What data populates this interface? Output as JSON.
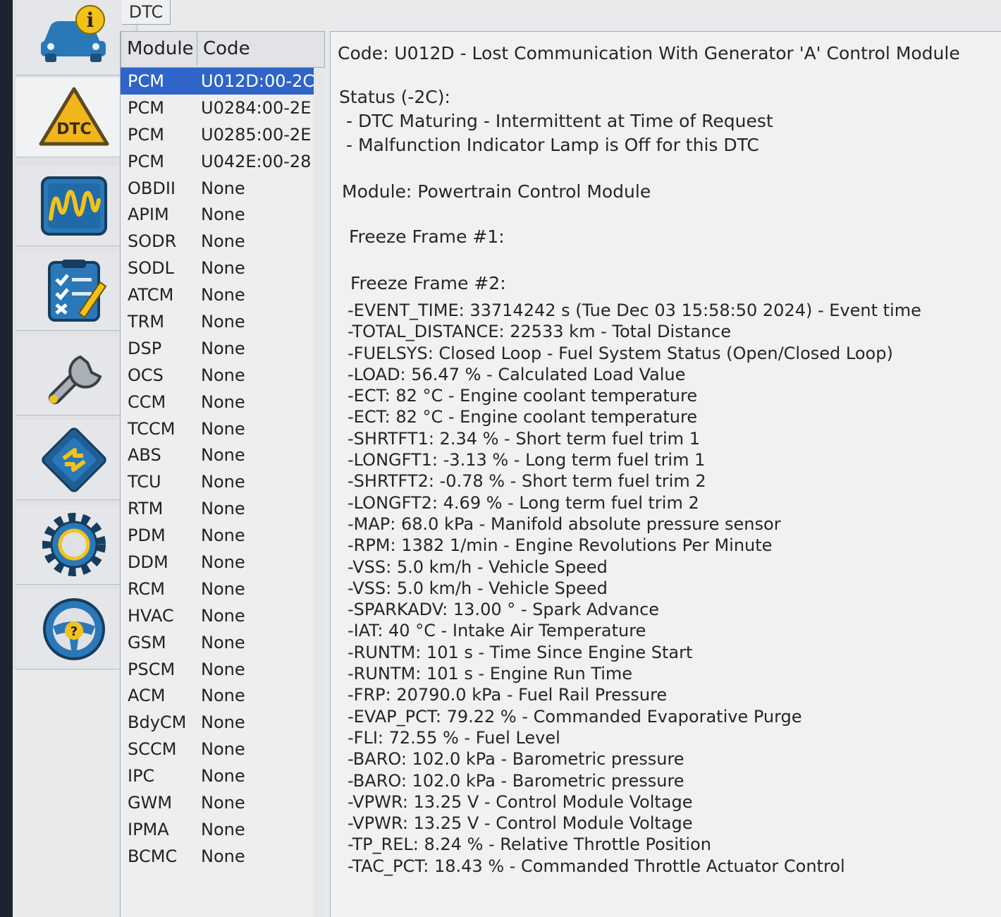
{
  "tab": {
    "label": "DTC"
  },
  "sidebar": {
    "items": [
      {
        "name": "vehicle-info",
        "icon": "car-info-icon",
        "badge": "i"
      },
      {
        "name": "dtc",
        "icon": "dtc-warning-icon",
        "badge": "DTC"
      },
      {
        "name": "live-data",
        "icon": "waveform-icon"
      },
      {
        "name": "checklist",
        "icon": "checklist-icon"
      },
      {
        "name": "service",
        "icon": "wrench-icon"
      },
      {
        "name": "modules",
        "icon": "chip-icon"
      },
      {
        "name": "settings",
        "icon": "gear-icon"
      },
      {
        "name": "help",
        "icon": "help-steering-icon",
        "badge": "?"
      }
    ]
  },
  "dtc_list": {
    "headers": {
      "module": "Module",
      "code": "Code"
    },
    "rows": [
      {
        "module": "PCM",
        "code": "U012D:00-2C",
        "selected": true
      },
      {
        "module": "PCM",
        "code": "U0284:00-2E"
      },
      {
        "module": "PCM",
        "code": "U0285:00-2E"
      },
      {
        "module": "PCM",
        "code": "U042E:00-28"
      },
      {
        "module": "OBDII",
        "code": "None"
      },
      {
        "module": "APIM",
        "code": "None"
      },
      {
        "module": "SODR",
        "code": "None"
      },
      {
        "module": "SODL",
        "code": "None"
      },
      {
        "module": "ATCM",
        "code": "None"
      },
      {
        "module": "TRM",
        "code": "None"
      },
      {
        "module": "DSP",
        "code": "None"
      },
      {
        "module": "OCS",
        "code": "None"
      },
      {
        "module": "CCM",
        "code": "None"
      },
      {
        "module": "TCCM",
        "code": "None"
      },
      {
        "module": "ABS",
        "code": "None"
      },
      {
        "module": "TCU",
        "code": "None"
      },
      {
        "module": "RTM",
        "code": "None"
      },
      {
        "module": "PDM",
        "code": "None"
      },
      {
        "module": "DDM",
        "code": "None"
      },
      {
        "module": "RCM",
        "code": "None"
      },
      {
        "module": "HVAC",
        "code": "None"
      },
      {
        "module": "GSM",
        "code": "None"
      },
      {
        "module": "PSCM",
        "code": "None"
      },
      {
        "module": "ACM",
        "code": "None"
      },
      {
        "module": "BdyCM",
        "code": "None"
      },
      {
        "module": "SCCM",
        "code": "None"
      },
      {
        "module": "IPC",
        "code": "None"
      },
      {
        "module": "GWM",
        "code": "None"
      },
      {
        "module": "IPMA",
        "code": "None"
      },
      {
        "module": "BCMC",
        "code": "None"
      }
    ]
  },
  "details": {
    "code_line": "Code: U012D - Lost Communication With Generator 'A' Control Module",
    "status_title": "Status (-2C):",
    "status_lines": [
      "- DTC Maturing - Intermittent at Time of Request",
      "- Malfunction Indicator Lamp is Off for this DTC"
    ],
    "module_line": "Module: Powertrain Control Module",
    "freeze_frame_1": "Freeze Frame  #1:",
    "freeze_frame_2": "Freeze Frame  #2:",
    "freeze_frame_2_items": [
      "-EVENT_TIME: 33714242 s (Tue Dec 03 15:58:50 2024) - Event time",
      "-TOTAL_DISTANCE: 22533 km - Total Distance",
      "-FUELSYS: Closed Loop  - Fuel System Status (Open/Closed Loop)",
      "-LOAD: 56.47 % - Calculated Load Value",
      "-ECT: 82 °C - Engine coolant temperature",
      "-ECT: 82 °C - Engine coolant temperature",
      "-SHRTFT1: 2.34 % - Short term fuel trim 1",
      "-LONGFT1: -3.13 % - Long term fuel trim 1",
      "-SHRTFT2: -0.78 % - Short term fuel trim 2",
      "-LONGFT2: 4.69 % - Long term fuel trim 2",
      "-MAP: 68.0 kPa - Manifold absolute pressure sensor",
      "-RPM: 1382 1/min - Engine Revolutions Per Minute",
      "-VSS: 5.0 km/h - Vehicle Speed",
      "-VSS: 5.0 km/h - Vehicle Speed",
      "-SPARKADV: 13.00 ° - Spark Advance",
      "-IAT: 40 °C - Intake Air Temperature",
      "-RUNTM: 101 s - Time Since Engine Start",
      "-RUNTM: 101 s - Engine Run Time",
      "-FRP: 20790.0 kPa - Fuel Rail Pressure",
      "-EVAP_PCT: 79.22 % - Commanded Evaporative Purge",
      "-FLI: 72.55 % - Fuel Level",
      "-BARO: 102.0 kPa - Barometric pressure",
      "-BARO: 102.0 kPa - Barometric pressure",
      "-VPWR: 13.25 V - Control Module Voltage",
      "-VPWR: 13.25 V - Control Module Voltage",
      "-TP_REL: 8.24 % - Relative Throttle Position",
      "-TAC_PCT: 18.43 % - Commanded Throttle Actuator Control"
    ]
  },
  "colors": {
    "selection": "#2f64c8",
    "icon_blue": "#2a78b8",
    "icon_yellow": "#f2c21b"
  }
}
